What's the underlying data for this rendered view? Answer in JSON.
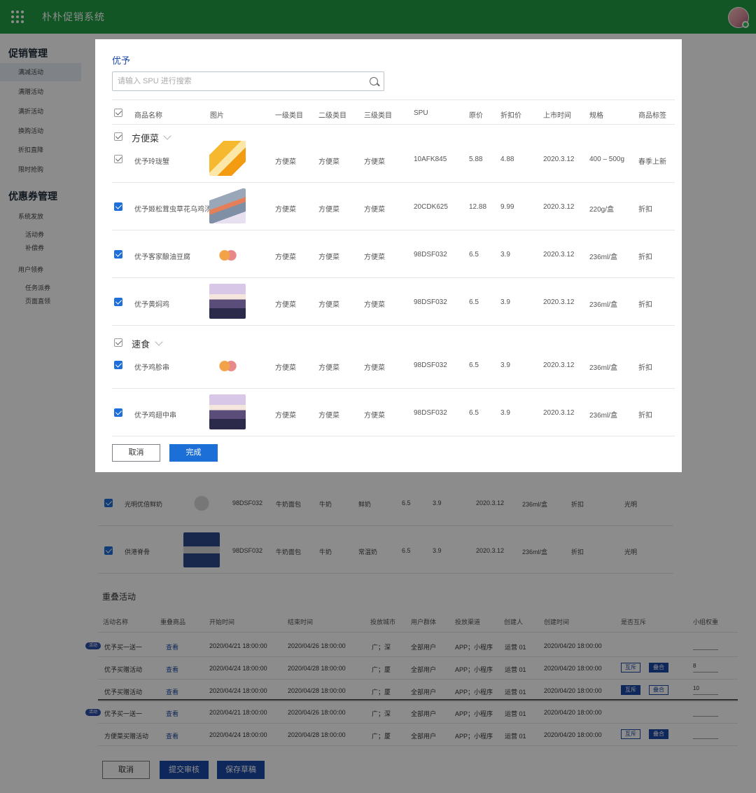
{
  "app": {
    "title": "朴朴促销系统"
  },
  "sidebar": {
    "section1_title": "促销管理",
    "section1_items": [
      "满减活动",
      "满赠活动",
      "满折活动",
      "换购活动",
      "折扣直降",
      "限时抢购"
    ],
    "section2_title": "优惠券管理",
    "section2_items": [
      "系统发放",
      "活动券",
      "补偿券",
      "用户领券",
      "任务派券",
      "页面直领"
    ]
  },
  "background": {
    "rows": [
      {
        "name": "光明优倍鲜奶",
        "spu": "98DSF032",
        "cat1": "牛奶面包",
        "cat2": "牛奶",
        "cat3": "鲜奶",
        "price": "6.5",
        "discount": "3.9",
        "date": "2020.3.12",
        "spec": "236ml/盒",
        "tag": "折扣",
        "brand": "光明"
      },
      {
        "name": "供港脊骨",
        "spu": "98DSF032",
        "cat1": "牛奶面包",
        "cat2": "牛奶",
        "cat3": "常温奶",
        "price": "6.5",
        "discount": "3.9",
        "date": "2020.3.12",
        "spec": "236ml/盒",
        "tag": "折扣",
        "brand": "光明"
      }
    ],
    "stack_section_title": "重叠活动",
    "stack_headers": [
      "活动名称",
      "重叠商品",
      "开始时间",
      "结束时间",
      "投放城市",
      "用户群体",
      "投放渠道",
      "创建人",
      "创建时间",
      "是否互斥",
      "小组权重"
    ],
    "stack_rows": [
      {
        "pill": "活动",
        "name": "优予买一送一",
        "view": "查看",
        "start": "2020/04/21 18:00:00",
        "end": "2020/04/26 18:00:00",
        "city": "广；深",
        "group": "全部用户",
        "channel": "APP；小程序",
        "creator": "运营 01",
        "created": "2020/04/20 18:00:00",
        "weight": ""
      },
      {
        "pill": "",
        "name": "优予买赠活动",
        "view": "查看",
        "start": "2020/04/24 18:00:00",
        "end": "2020/04/28 18:00:00",
        "city": "广；厦",
        "group": "全部用户",
        "channel": "APP；小程序",
        "creator": "运营 01",
        "created": "2020/04/20 18:00:00",
        "mutex_a": "互斥",
        "mutex_b": "叠合",
        "weight": "8"
      },
      {
        "pill": "",
        "name": "优予买赠活动",
        "view": "查看",
        "start": "2020/04/24 18:00:00",
        "end": "2020/04/28 18:00:00",
        "city": "广；厦",
        "group": "全部用户",
        "channel": "APP；小程序",
        "creator": "运营 01",
        "created": "2020/04/20 18:00:00",
        "mutex_a": "互斥",
        "mutex_b": "叠合",
        "weight": "10"
      },
      {
        "pill": "活动",
        "name": "优予买一送一",
        "view": "查看",
        "start": "2020/04/21 18:00:00",
        "end": "2020/04/26 18:00:00",
        "city": "广；深",
        "group": "全部用户",
        "channel": "APP；小程序",
        "creator": "运营 01",
        "created": "2020/04/20 18:00:00",
        "weight": ""
      },
      {
        "pill": "",
        "name": "方便菜买赠活动",
        "view": "查看",
        "start": "2020/04/24 18:00:00",
        "end": "2020/04/28 18:00:00",
        "city": "广；厦",
        "group": "全部用户",
        "channel": "APP；小程序",
        "creator": "运营 01",
        "created": "2020/04/20 18:00:00",
        "mutex_a": "互斥",
        "mutex_b": "叠合",
        "weight": ""
      }
    ],
    "buttons": {
      "cancel": "取消",
      "submit": "提交审核",
      "draft": "保存草稿"
    }
  },
  "modal": {
    "title": "优予",
    "search_placeholder": "请输入 SPU 进行搜索",
    "headers": [
      "商品名称",
      "图片",
      "一级类目",
      "二级类目",
      "三级类目",
      "SPU",
      "原价",
      "折扣价",
      "上市时间",
      "规格",
      "商品标签"
    ],
    "groups": [
      {
        "label": "方便菜",
        "items": [
          {
            "name": "优予玲珑蟹",
            "cat1": "方便菜",
            "cat2": "方便菜",
            "cat3": "方便菜",
            "spu": "10AFK845",
            "price": "5.88",
            "discount": "4.88",
            "date": "2020.3.12",
            "spec": "400 – 500g",
            "tag": "春季上新",
            "checked": false
          },
          {
            "name": "优予姬松茸虫草花乌鸡汤",
            "cat1": "方便菜",
            "cat2": "方便菜",
            "cat3": "方便菜",
            "spu": "20CDK625",
            "price": "12.88",
            "discount": "9.99",
            "date": "2020.3.12",
            "spec": "220g/盒",
            "tag": "折扣",
            "checked": true
          },
          {
            "name": "优予客家酿油豆腐",
            "cat1": "方便菜",
            "cat2": "方便菜",
            "cat3": "方便菜",
            "spu": "98DSF032",
            "price": "6.5",
            "discount": "3.9",
            "date": "2020.3.12",
            "spec": "236ml/盒",
            "tag": "折扣",
            "checked": true
          },
          {
            "name": "优予黄焖鸡",
            "cat1": "方便菜",
            "cat2": "方便菜",
            "cat3": "方便菜",
            "spu": "98DSF032",
            "price": "6.5",
            "discount": "3.9",
            "date": "2020.3.12",
            "spec": "236ml/盒",
            "tag": "折扣",
            "checked": true
          }
        ]
      },
      {
        "label": "速食",
        "items": [
          {
            "name": "优予鸡胗串",
            "cat1": "方便菜",
            "cat2": "方便菜",
            "cat3": "方便菜",
            "spu": "98DSF032",
            "price": "6.5",
            "discount": "3.9",
            "date": "2020.3.12",
            "spec": "236ml/盒",
            "tag": "折扣",
            "checked": true
          },
          {
            "name": "优予鸡翅中串",
            "cat1": "方便菜",
            "cat2": "方便菜",
            "cat3": "方便菜",
            "spu": "98DSF032",
            "price": "6.5",
            "discount": "3.9",
            "date": "2020.3.12",
            "spec": "236ml/盒",
            "tag": "折扣",
            "checked": true
          }
        ]
      }
    ],
    "buttons": {
      "cancel": "取消",
      "done": "完成"
    }
  }
}
